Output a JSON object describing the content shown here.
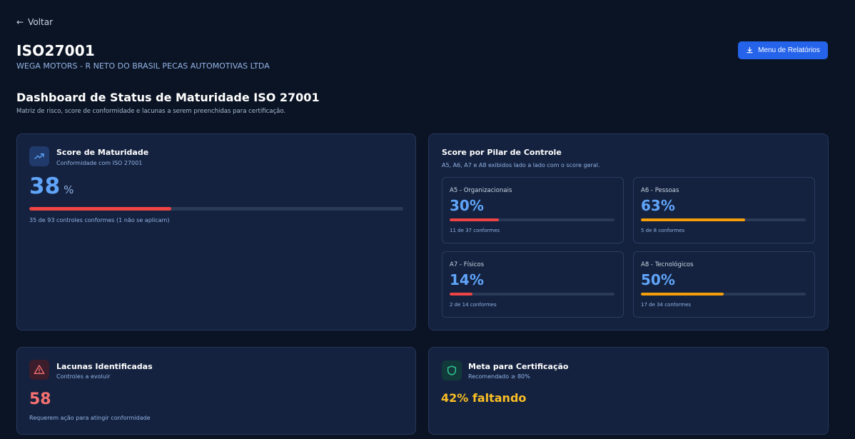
{
  "nav": {
    "back_label": "Voltar"
  },
  "header": {
    "title": "ISO27001",
    "company": "WEGA MOTORS - R NETO DO BRASIL PECAS AUTOMOTIVAS LTDA",
    "report_button_label": "Menu de Relatórios"
  },
  "section": {
    "title": "Dashboard de Status de Maturidade ISO 27001",
    "description": "Matriz de risco, score de conformidade e lacunas a serem preenchidas para certificação."
  },
  "maturity": {
    "title": "Score de Maturidade",
    "subtitle": "Conformidade com ISO 27001",
    "score": "38",
    "unit": "%",
    "progress_fraction": 0.38,
    "bar_color": "#ef4444",
    "note": "35 de 93 controles conformes (1 não se aplicam)"
  },
  "pillars": {
    "title": "Score por Pilar de Controle",
    "subtitle": "A5, A6, A7 e A8 exibidos lado a lado com o score geral.",
    "items": [
      {
        "label": "A5 - Organizacionais",
        "percent": "30%",
        "fraction": 0.3,
        "color": "#ef4444",
        "count": "11 de 37 conformes"
      },
      {
        "label": "A6 - Pessoas",
        "percent": "63%",
        "fraction": 0.63,
        "color": "#f59e0b",
        "count": "5 de 8 conformes"
      },
      {
        "label": "A7 - Físicos",
        "percent": "14%",
        "fraction": 0.14,
        "color": "#ef4444",
        "count": "2 de 14 conformes"
      },
      {
        "label": "A8 - Tecnológicos",
        "percent": "50%",
        "fraction": 0.5,
        "color": "#f59e0b",
        "count": "17 de 34 conformes"
      }
    ]
  },
  "gaps": {
    "title": "Lacunas Identificadas",
    "subtitle": "Controles a evoluir",
    "count": "58",
    "note": "Requerem ação para atingir conformidade"
  },
  "goal": {
    "title": "Meta para Certificação",
    "subtitle": "Recomendado ≥ 80%",
    "remaining": "42% faltando"
  },
  "icons": {
    "back": "arrow-left-icon",
    "download": "download-icon",
    "trend": "trending-up-icon",
    "alert": "alert-triangle-icon",
    "shield": "shield-icon"
  }
}
